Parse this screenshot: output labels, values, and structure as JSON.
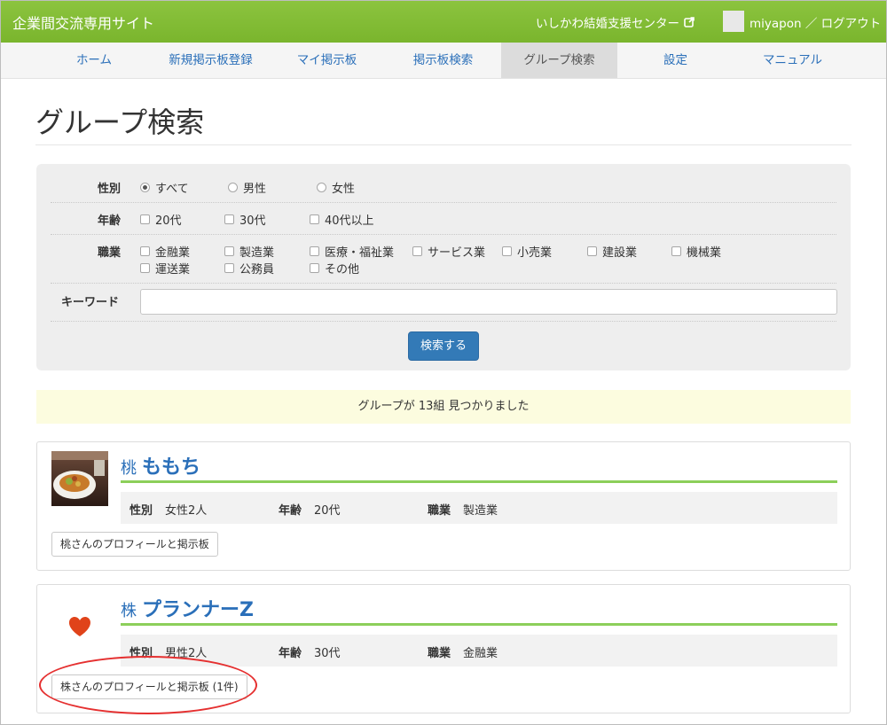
{
  "header": {
    "site_title": "企業間交流専用サイト",
    "center_link": "いしかわ結婚支援センター",
    "user_text": "miyapon ／ ログアウト"
  },
  "nav": {
    "items": [
      {
        "label": "ホーム"
      },
      {
        "label": "新規掲示板登録"
      },
      {
        "label": "マイ掲示板"
      },
      {
        "label": "掲示板検索"
      },
      {
        "label": "グループ検索",
        "active": true
      },
      {
        "label": "設定"
      },
      {
        "label": "マニュアル"
      }
    ]
  },
  "page": {
    "title": "グループ検索"
  },
  "search": {
    "gender": {
      "label": "性別",
      "options": [
        "すべて",
        "男性",
        "女性"
      ],
      "selected": "すべて"
    },
    "age": {
      "label": "年齢",
      "options": [
        "20代",
        "30代",
        "40代以上"
      ]
    },
    "job": {
      "label": "職業",
      "options": [
        "金融業",
        "製造業",
        "医療・福祉業",
        "サービス業",
        "小売業",
        "建設業",
        "機械業",
        "運送業",
        "公務員",
        "その他"
      ]
    },
    "keyword": {
      "label": "キーワード",
      "value": "",
      "placeholder": ""
    },
    "submit_label": "検索する"
  },
  "result_message": "グループが 13組 見つかりました",
  "groups": [
    {
      "prefix": "桃",
      "name": "ももち",
      "gender_label": "性別",
      "gender": "女性2人",
      "age_label": "年齢",
      "age": "20代",
      "job_label": "職業",
      "job": "製造業",
      "profile_button": "桃さんのプロフィールと掲示板"
    },
    {
      "prefix": "株",
      "name": "プランナーZ",
      "gender_label": "性別",
      "gender": "男性2人",
      "age_label": "年齢",
      "age": "30代",
      "job_label": "職業",
      "job": "金融業",
      "profile_button": "株さんのプロフィールと掲示板 (1件)"
    }
  ],
  "colors": {
    "topbar": "#7ab52d",
    "link": "#2a6fb9",
    "primary_button": "#337ab7",
    "accent_rule": "#8ccf5a",
    "annotation": "#e53030",
    "heart": "#e0431a"
  }
}
